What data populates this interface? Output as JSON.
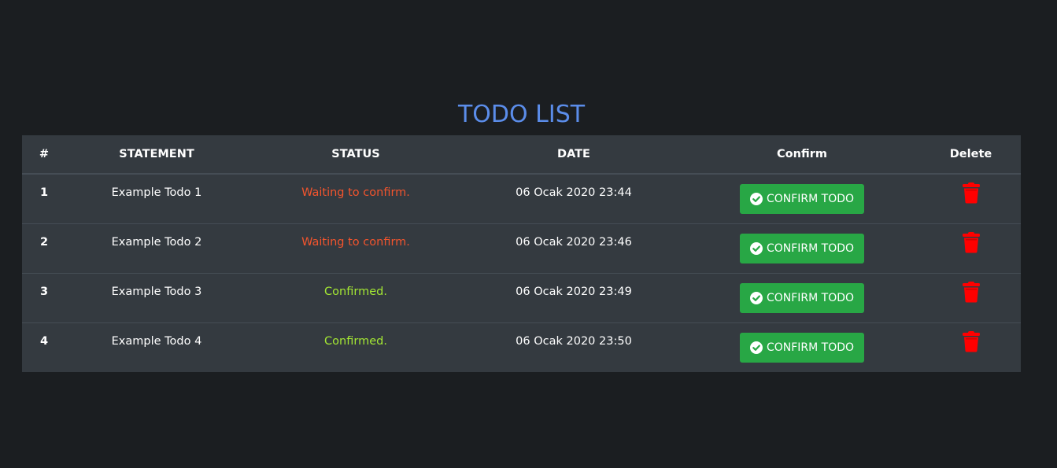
{
  "page": {
    "title": "TODO LIST"
  },
  "table": {
    "headers": {
      "num": "#",
      "statement": "STATEMENT",
      "status": "STATUS",
      "date": "DATE",
      "confirm": "Confirm",
      "delete": "Delete"
    },
    "rows": [
      {
        "num": "1",
        "statement": "Example Todo 1",
        "status": "Waiting to confirm.",
        "status_state": "waiting",
        "date": "06 Ocak 2020 23:44",
        "confirm_label": "CONFIRM TODO"
      },
      {
        "num": "2",
        "statement": "Example Todo 2",
        "status": "Waiting to confirm.",
        "status_state": "waiting",
        "date": "06 Ocak 2020 23:46",
        "confirm_label": "CONFIRM TODO"
      },
      {
        "num": "3",
        "statement": "Example Todo 3",
        "status": "Confirmed.",
        "status_state": "confirmed",
        "date": "06 Ocak 2020 23:49",
        "confirm_label": "CONFIRM TODO"
      },
      {
        "num": "4",
        "statement": "Example Todo 4",
        "status": "Confirmed.",
        "status_state": "confirmed",
        "date": "06 Ocak 2020 23:50",
        "confirm_label": "CONFIRM TODO"
      }
    ]
  },
  "icons": {
    "confirm": "check-circle-icon",
    "delete": "trash-icon"
  },
  "colors": {
    "background": "#1b1e21",
    "table": "#343a40",
    "title": "#5b8dea",
    "waiting": "#f2542d",
    "confirmed": "#a5e933",
    "confirm_button": "#28a745",
    "delete_icon": "#ff0000"
  }
}
